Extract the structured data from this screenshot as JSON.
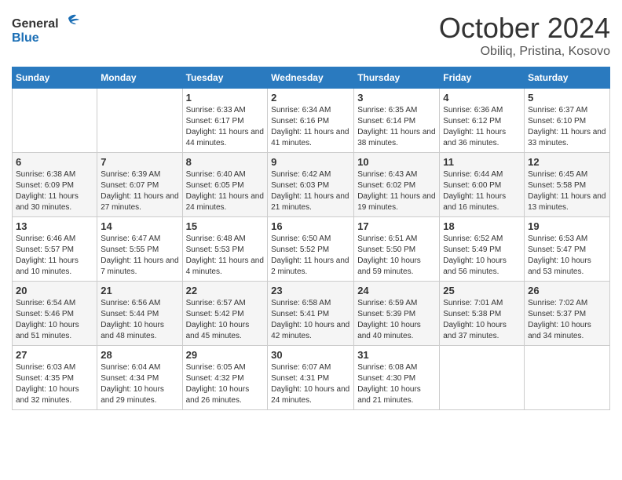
{
  "logo": {
    "line1": "General",
    "line2": "Blue"
  },
  "title": "October 2024",
  "location": "Obiliq, Pristina, Kosovo",
  "days_of_week": [
    "Sunday",
    "Monday",
    "Tuesday",
    "Wednesday",
    "Thursday",
    "Friday",
    "Saturday"
  ],
  "weeks": [
    [
      {
        "day": "",
        "sunrise": "",
        "sunset": "",
        "daylight": ""
      },
      {
        "day": "",
        "sunrise": "",
        "sunset": "",
        "daylight": ""
      },
      {
        "day": "1",
        "sunrise": "Sunrise: 6:33 AM",
        "sunset": "Sunset: 6:17 PM",
        "daylight": "Daylight: 11 hours and 44 minutes."
      },
      {
        "day": "2",
        "sunrise": "Sunrise: 6:34 AM",
        "sunset": "Sunset: 6:16 PM",
        "daylight": "Daylight: 11 hours and 41 minutes."
      },
      {
        "day": "3",
        "sunrise": "Sunrise: 6:35 AM",
        "sunset": "Sunset: 6:14 PM",
        "daylight": "Daylight: 11 hours and 38 minutes."
      },
      {
        "day": "4",
        "sunrise": "Sunrise: 6:36 AM",
        "sunset": "Sunset: 6:12 PM",
        "daylight": "Daylight: 11 hours and 36 minutes."
      },
      {
        "day": "5",
        "sunrise": "Sunrise: 6:37 AM",
        "sunset": "Sunset: 6:10 PM",
        "daylight": "Daylight: 11 hours and 33 minutes."
      }
    ],
    [
      {
        "day": "6",
        "sunrise": "Sunrise: 6:38 AM",
        "sunset": "Sunset: 6:09 PM",
        "daylight": "Daylight: 11 hours and 30 minutes."
      },
      {
        "day": "7",
        "sunrise": "Sunrise: 6:39 AM",
        "sunset": "Sunset: 6:07 PM",
        "daylight": "Daylight: 11 hours and 27 minutes."
      },
      {
        "day": "8",
        "sunrise": "Sunrise: 6:40 AM",
        "sunset": "Sunset: 6:05 PM",
        "daylight": "Daylight: 11 hours and 24 minutes."
      },
      {
        "day": "9",
        "sunrise": "Sunrise: 6:42 AM",
        "sunset": "Sunset: 6:03 PM",
        "daylight": "Daylight: 11 hours and 21 minutes."
      },
      {
        "day": "10",
        "sunrise": "Sunrise: 6:43 AM",
        "sunset": "Sunset: 6:02 PM",
        "daylight": "Daylight: 11 hours and 19 minutes."
      },
      {
        "day": "11",
        "sunrise": "Sunrise: 6:44 AM",
        "sunset": "Sunset: 6:00 PM",
        "daylight": "Daylight: 11 hours and 16 minutes."
      },
      {
        "day": "12",
        "sunrise": "Sunrise: 6:45 AM",
        "sunset": "Sunset: 5:58 PM",
        "daylight": "Daylight: 11 hours and 13 minutes."
      }
    ],
    [
      {
        "day": "13",
        "sunrise": "Sunrise: 6:46 AM",
        "sunset": "Sunset: 5:57 PM",
        "daylight": "Daylight: 11 hours and 10 minutes."
      },
      {
        "day": "14",
        "sunrise": "Sunrise: 6:47 AM",
        "sunset": "Sunset: 5:55 PM",
        "daylight": "Daylight: 11 hours and 7 minutes."
      },
      {
        "day": "15",
        "sunrise": "Sunrise: 6:48 AM",
        "sunset": "Sunset: 5:53 PM",
        "daylight": "Daylight: 11 hours and 4 minutes."
      },
      {
        "day": "16",
        "sunrise": "Sunrise: 6:50 AM",
        "sunset": "Sunset: 5:52 PM",
        "daylight": "Daylight: 11 hours and 2 minutes."
      },
      {
        "day": "17",
        "sunrise": "Sunrise: 6:51 AM",
        "sunset": "Sunset: 5:50 PM",
        "daylight": "Daylight: 10 hours and 59 minutes."
      },
      {
        "day": "18",
        "sunrise": "Sunrise: 6:52 AM",
        "sunset": "Sunset: 5:49 PM",
        "daylight": "Daylight: 10 hours and 56 minutes."
      },
      {
        "day": "19",
        "sunrise": "Sunrise: 6:53 AM",
        "sunset": "Sunset: 5:47 PM",
        "daylight": "Daylight: 10 hours and 53 minutes."
      }
    ],
    [
      {
        "day": "20",
        "sunrise": "Sunrise: 6:54 AM",
        "sunset": "Sunset: 5:46 PM",
        "daylight": "Daylight: 10 hours and 51 minutes."
      },
      {
        "day": "21",
        "sunrise": "Sunrise: 6:56 AM",
        "sunset": "Sunset: 5:44 PM",
        "daylight": "Daylight: 10 hours and 48 minutes."
      },
      {
        "day": "22",
        "sunrise": "Sunrise: 6:57 AM",
        "sunset": "Sunset: 5:42 PM",
        "daylight": "Daylight: 10 hours and 45 minutes."
      },
      {
        "day": "23",
        "sunrise": "Sunrise: 6:58 AM",
        "sunset": "Sunset: 5:41 PM",
        "daylight": "Daylight: 10 hours and 42 minutes."
      },
      {
        "day": "24",
        "sunrise": "Sunrise: 6:59 AM",
        "sunset": "Sunset: 5:39 PM",
        "daylight": "Daylight: 10 hours and 40 minutes."
      },
      {
        "day": "25",
        "sunrise": "Sunrise: 7:01 AM",
        "sunset": "Sunset: 5:38 PM",
        "daylight": "Daylight: 10 hours and 37 minutes."
      },
      {
        "day": "26",
        "sunrise": "Sunrise: 7:02 AM",
        "sunset": "Sunset: 5:37 PM",
        "daylight": "Daylight: 10 hours and 34 minutes."
      }
    ],
    [
      {
        "day": "27",
        "sunrise": "Sunrise: 6:03 AM",
        "sunset": "Sunset: 4:35 PM",
        "daylight": "Daylight: 10 hours and 32 minutes."
      },
      {
        "day": "28",
        "sunrise": "Sunrise: 6:04 AM",
        "sunset": "Sunset: 4:34 PM",
        "daylight": "Daylight: 10 hours and 29 minutes."
      },
      {
        "day": "29",
        "sunrise": "Sunrise: 6:05 AM",
        "sunset": "Sunset: 4:32 PM",
        "daylight": "Daylight: 10 hours and 26 minutes."
      },
      {
        "day": "30",
        "sunrise": "Sunrise: 6:07 AM",
        "sunset": "Sunset: 4:31 PM",
        "daylight": "Daylight: 10 hours and 24 minutes."
      },
      {
        "day": "31",
        "sunrise": "Sunrise: 6:08 AM",
        "sunset": "Sunset: 4:30 PM",
        "daylight": "Daylight: 10 hours and 21 minutes."
      },
      {
        "day": "",
        "sunrise": "",
        "sunset": "",
        "daylight": ""
      },
      {
        "day": "",
        "sunrise": "",
        "sunset": "",
        "daylight": ""
      }
    ]
  ]
}
